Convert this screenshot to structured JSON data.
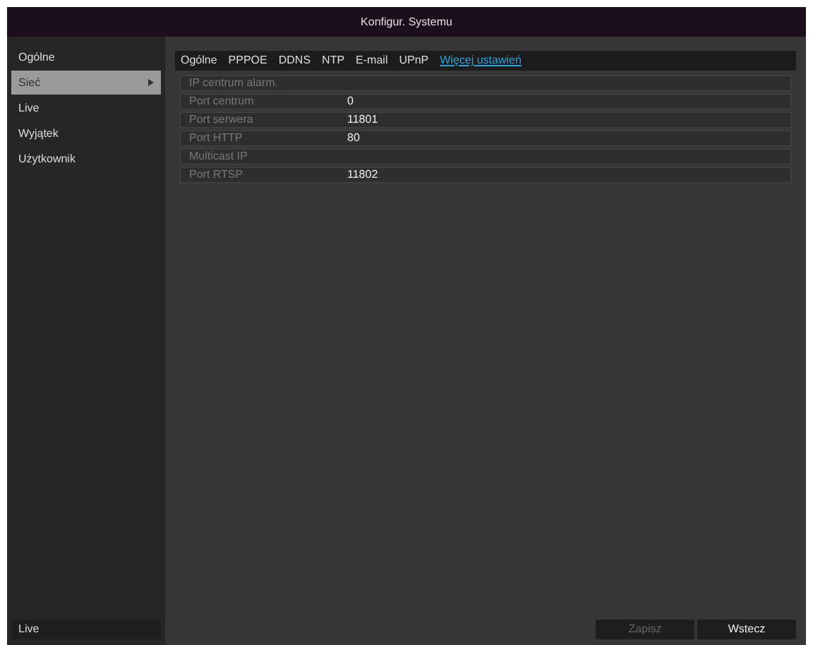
{
  "window": {
    "title": "Konfigur. Systemu"
  },
  "sidebar": {
    "items": [
      {
        "label": "Ogólne",
        "selected": false
      },
      {
        "label": "Sieć",
        "selected": true
      },
      {
        "label": "Live",
        "selected": false
      },
      {
        "label": "Wyjątek",
        "selected": false
      },
      {
        "label": "Użytkownik",
        "selected": false
      }
    ],
    "footer": "Live"
  },
  "tabs": [
    {
      "label": "Ogólne",
      "selected": false
    },
    {
      "label": "PPPOE",
      "selected": false
    },
    {
      "label": "DDNS",
      "selected": false
    },
    {
      "label": "NTP",
      "selected": false
    },
    {
      "label": "E-mail",
      "selected": false
    },
    {
      "label": "UPnP",
      "selected": false
    },
    {
      "label": "Więcej ustawień",
      "selected": true
    }
  ],
  "fields": [
    {
      "label": "IP centrum alarm."
    },
    {
      "label": "Port centrum",
      "value": "0"
    },
    {
      "label": "Port serwera",
      "value": "11801"
    },
    {
      "label": "Port HTTP",
      "value": "80"
    },
    {
      "label": "Multicast IP"
    },
    {
      "label": "Port RTSP",
      "value": "11802"
    }
  ],
  "buttons": [
    {
      "label": "Zapisz",
      "disabled": true
    },
    {
      "label": "Wstecz",
      "disabled": false
    }
  ]
}
